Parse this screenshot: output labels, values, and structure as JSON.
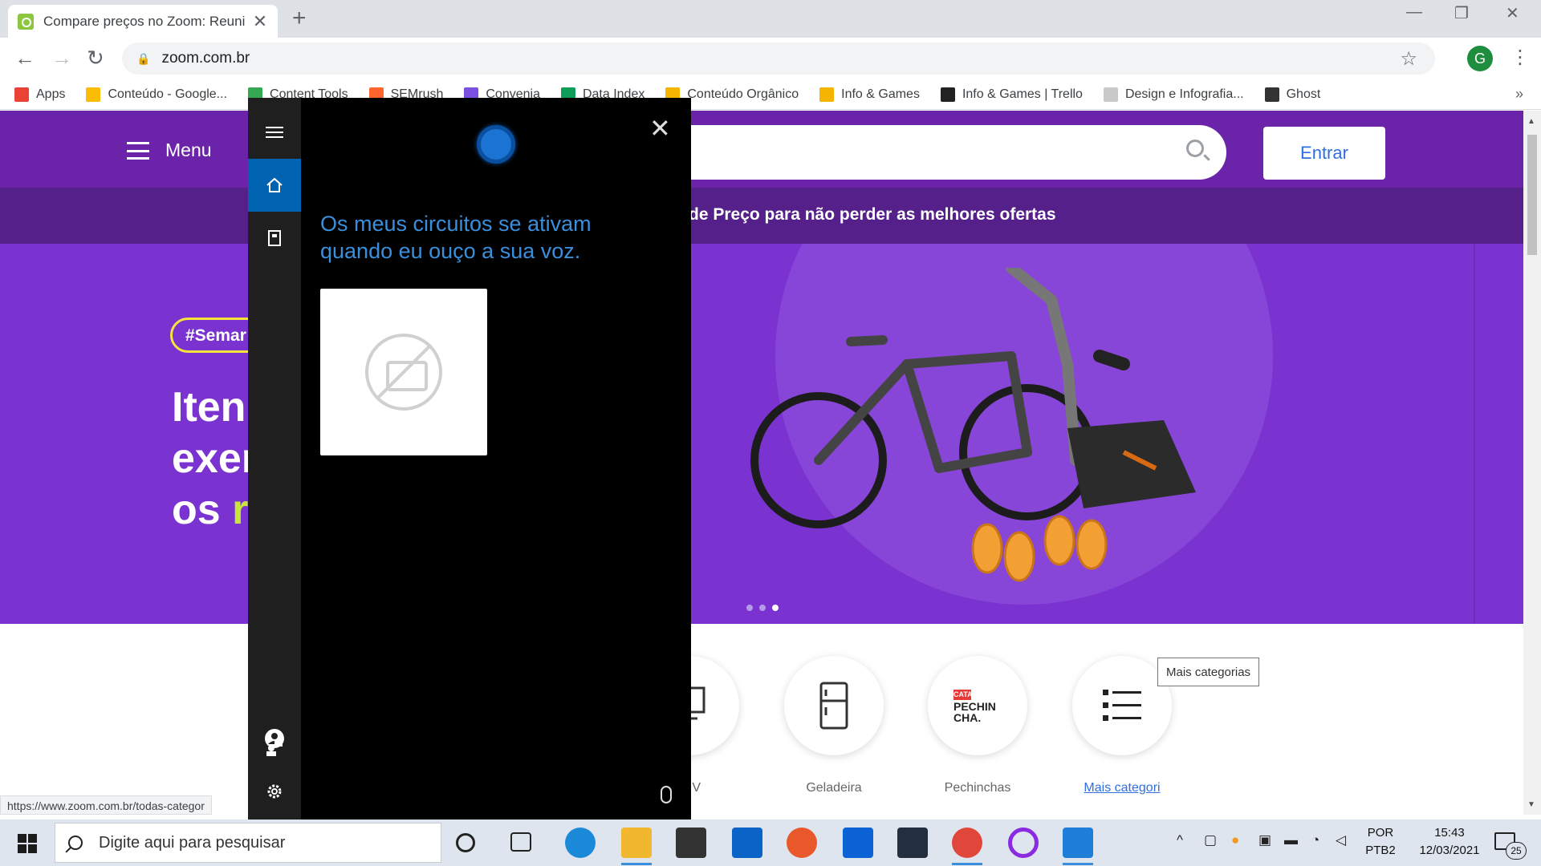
{
  "browser": {
    "tab_title": "Compare preços no Zoom: Reuni",
    "tab_close": "✕",
    "new_tab": "+",
    "url": "zoom.com.br",
    "profile_initial": "G",
    "bookmarks": [
      {
        "label": "Apps",
        "color": "#ea4335"
      },
      {
        "label": "Conteúdo - Google...",
        "color": "#fbbc04"
      },
      {
        "label": "Content Tools",
        "color": "#34a853"
      },
      {
        "label": "SEMrush",
        "color": "#ff642d"
      },
      {
        "label": "Convenia",
        "color": "#7b4fe0"
      },
      {
        "label": "Data Index",
        "color": "#0f9d58"
      },
      {
        "label": "Conteúdo Orgânico",
        "color": "#f4b400"
      },
      {
        "label": "Info & Games",
        "color": "#f4b400"
      },
      {
        "label": "Info & Games | Trello",
        "color": "#222222"
      },
      {
        "label": "Design e Infografia...",
        "color": "#c9c9c9"
      },
      {
        "label": "Ghost",
        "color": "#333333"
      }
    ],
    "more_bookmarks": "»",
    "status_url": "https://www.zoom.com.br/todas-categor"
  },
  "site": {
    "menu_label": "Menu",
    "login_label": "Entrar",
    "promo_text": "de Preço para não perder as melhores ofertas",
    "hero_hashtag": "#Semar",
    "hero_lines": [
      "Iten",
      "exer",
      "os "
    ],
    "hero_highlight": "r",
    "categories": [
      {
        "label": "V",
        "icon": "tv-icon"
      },
      {
        "label": "Geladeira",
        "icon": "fridge-icon"
      },
      {
        "label": "Pechinchas",
        "icon": "pechinchas-logo"
      },
      {
        "label": "Mais categori",
        "icon": "list-icon"
      }
    ],
    "pechinchas_tag": "CATA",
    "pechinchas_text": "PECHIN CHA.",
    "tooltip": "Mais categorias",
    "colors": {
      "header": "#6a23a9",
      "promo": "#55208a",
      "hero": "#7a33d0",
      "link": "#2f6fe0"
    }
  },
  "cortana": {
    "message": "Os meus circuitos se ativam quando eu ouço a sua voz.",
    "close": "✕",
    "accent": "#0063b1"
  },
  "taskbar": {
    "search_placeholder": "Digite aqui para pesquisar",
    "lang_line1": "POR",
    "lang_line2": "PTB2",
    "time": "15:43",
    "date": "12/03/2021",
    "notification_count": "25"
  }
}
